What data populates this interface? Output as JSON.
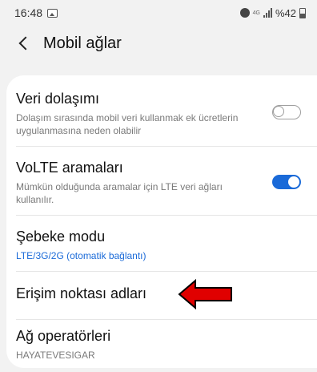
{
  "status_bar": {
    "time": "16:48",
    "network_badge": "4G",
    "battery": "%42"
  },
  "header": {
    "title": "Mobil ağlar"
  },
  "settings": [
    {
      "title": "Veri dolaşımı",
      "subtitle": "Dolaşım sırasında mobil veri kullanmak ek ücretlerin uygulanmasına neden olabilir",
      "toggle": "off"
    },
    {
      "title": "VoLTE aramaları",
      "subtitle": "Mümkün olduğunda aramalar için LTE veri ağları kullanılır.",
      "toggle": "on"
    },
    {
      "title": "Şebeke modu",
      "subtitle": "LTE/3G/2G (otomatik bağlantı)"
    },
    {
      "title": "Erişim noktası adları"
    },
    {
      "title": "Ağ operatörleri",
      "subtitle": "HAYATEVESIGAR"
    }
  ],
  "colors": {
    "accent": "#1a6ad8",
    "arrow": "#e00000",
    "background": "#f2f2f2"
  },
  "icons": [
    "image-icon",
    "alarm-icon",
    "signal-icon",
    "battery-icon",
    "back-chevron-icon",
    "red-arrow-icon"
  ]
}
